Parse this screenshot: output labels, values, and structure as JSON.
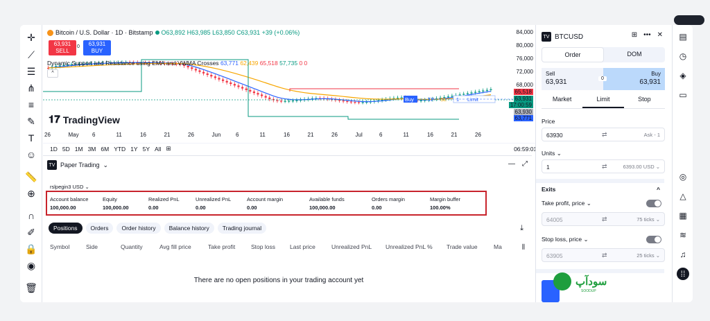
{
  "chart": {
    "symbol": "Bitcoin / U.S. Dollar · 1D · Bitstamp",
    "ohlc": "O63,892 H63,985 L63,850 C63,931 +39 (+0.06%)",
    "sell": {
      "price": "63,931",
      "label": "SELL"
    },
    "buy": {
      "price": "63,931",
      "label": "BUY"
    },
    "spread": "0",
    "indicator": {
      "name": "Dynamic Support and Resistance using EMA and VWMA Crosses",
      "v1": "63,771",
      "v2": "62,439",
      "v3": "65,518",
      "v4": "57,735",
      "v5": "0",
      "v6": "0"
    },
    "logo_text": "TradingView",
    "x_ticks": [
      "26",
      "May",
      "6",
      "11",
      "16",
      "21",
      "26",
      "Jun",
      "6",
      "11",
      "16",
      "21",
      "26",
      "Jul",
      "6",
      "11",
      "16",
      "21",
      "26"
    ],
    "y_ticks": [
      "84,000",
      "80,000",
      "76,000",
      "72,000",
      "68,000"
    ],
    "price_labels": [
      "65,518",
      "63,931",
      "17:00:59",
      "63,930",
      "63,771"
    ],
    "order_line": {
      "side": "Buy",
      "tp": "TP",
      "sl": "SL",
      "qty": "1",
      "type": "Limit"
    },
    "colors": {
      "up": "#089981",
      "down": "#f23645",
      "ema": "#2962ff",
      "vwma": "#f7a600"
    }
  },
  "timebar": {
    "ranges": [
      "1D",
      "5D",
      "1M",
      "3M",
      "6M",
      "YTD",
      "1Y",
      "5Y",
      "All"
    ],
    "clock": "06:59:01 UTC"
  },
  "panel": {
    "title": "Paper Trading",
    "account": "rslpegin3 USD",
    "summary": [
      {
        "label": "Account balance",
        "value": "100,000.00"
      },
      {
        "label": "Equity",
        "value": "100,000.00"
      },
      {
        "label": "Realized PnL",
        "value": "0.00"
      },
      {
        "label": "Unrealized PnL",
        "value": "0.00"
      },
      {
        "label": "Account margin",
        "value": "0.00"
      },
      {
        "label": "Available funds",
        "value": "100,000.00"
      },
      {
        "label": "Orders margin",
        "value": "0.00"
      },
      {
        "label": "Margin buffer",
        "value": "100.00%"
      }
    ],
    "tabs": [
      "Positions",
      "Orders",
      "Order history",
      "Balance history",
      "Trading journal"
    ],
    "columns": [
      "Symbol",
      "Side",
      "Quantity",
      "Avg fill price",
      "Take profit",
      "Stop loss",
      "Last price",
      "Unrealized PnL",
      "Unrealized PnL %",
      "Trade value",
      "Ma"
    ],
    "empty": "There are no open positions in your trading account yet"
  },
  "order": {
    "symbol": "BTCUSD",
    "tabs": [
      "Order",
      "DOM"
    ],
    "sell": {
      "label": "Sell",
      "price": "63,931"
    },
    "buy": {
      "label": "Buy",
      "price": "63,931"
    },
    "spread": "0",
    "types": [
      "Market",
      "Limit",
      "Stop"
    ],
    "price_label": "Price",
    "price_value": "63930",
    "price_hint": "Ask - 1",
    "units_label": "Units",
    "units_value": "1",
    "units_hint": "6393.00 USD",
    "exits": "Exits",
    "tp_label": "Take profit, price",
    "tp_value": "64005",
    "tp_hint": "75 ticks",
    "sl_label": "Stop loss, price",
    "sl_value": "63905",
    "sl_hint": "25 ticks"
  },
  "watermark": {
    "text": "سودآپ",
    "sub": "SOODUP"
  }
}
